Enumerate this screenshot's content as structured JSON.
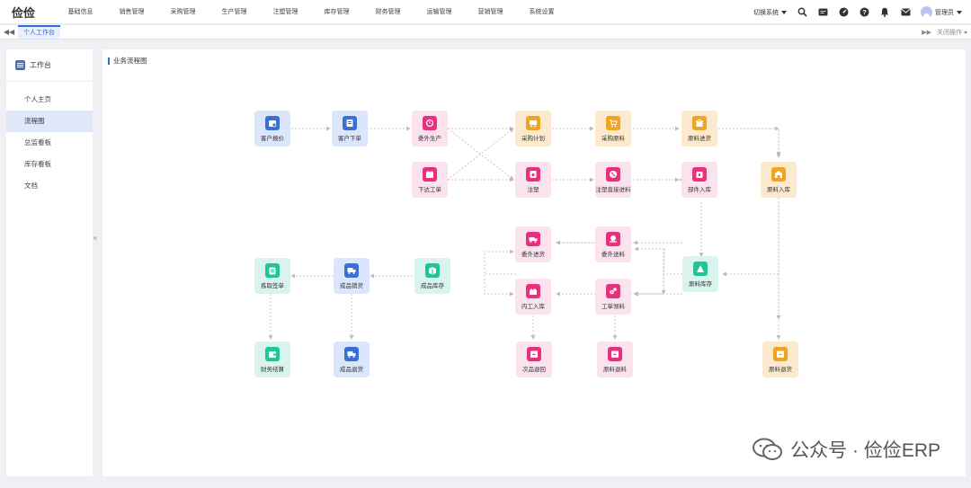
{
  "app": {
    "logo": "俭俭"
  },
  "menu": [
    "基础信息",
    "销售管理",
    "采购管理",
    "生产管理",
    "注塑管理",
    "库存管理",
    "财务管理",
    "运输管理",
    "营销管理",
    "系统设置"
  ],
  "topright": {
    "switch_label": "切换系统",
    "admin_label": "管理员"
  },
  "tabs": {
    "active": "个人工作台",
    "close_ops": "关闭操作"
  },
  "sidebar": {
    "title": "工作台",
    "items": [
      {
        "label": "个人主页"
      },
      {
        "label": "流程图"
      },
      {
        "label": "总监看板"
      },
      {
        "label": "库存看板"
      },
      {
        "label": "文档"
      }
    ]
  },
  "main": {
    "title": "业务流程图"
  },
  "flow": {
    "customer_quote": "客户报价",
    "customer_order": "客户下单",
    "outsource_production": "委外生产",
    "issue_work_order": "下达工单",
    "purchase_plan": "采购计划",
    "injection": "注塑",
    "purchase_material": "采购原料",
    "injection_direct_material": "注塑直接进料",
    "material_inbound": "原料进货",
    "part_inbound": "部件入库",
    "raw_material_inbound": "原料入库",
    "outsource_receive": "委外进货",
    "outsource_material": "委外送料",
    "raw_material_stock": "原料库存",
    "semi_inbound": "内工入库",
    "work_order_material": "工单领料",
    "finished_stock": "成品库存",
    "finished_sales": "成品销货",
    "pick_list": "拣取签单",
    "finance_settlement": "财务结算",
    "finished_return": "成品退货",
    "defect_return": "次品退回",
    "material_return": "原料退料",
    "material_refund": "原料退货"
  },
  "watermark": {
    "text": "公众号 · 俭俭ERP"
  },
  "colors": {
    "accent": "#2f6bd9",
    "blue": "#3a6fd8",
    "pink": "#ea2f7e",
    "orange": "#f0a41f",
    "green": "#1fc596"
  }
}
